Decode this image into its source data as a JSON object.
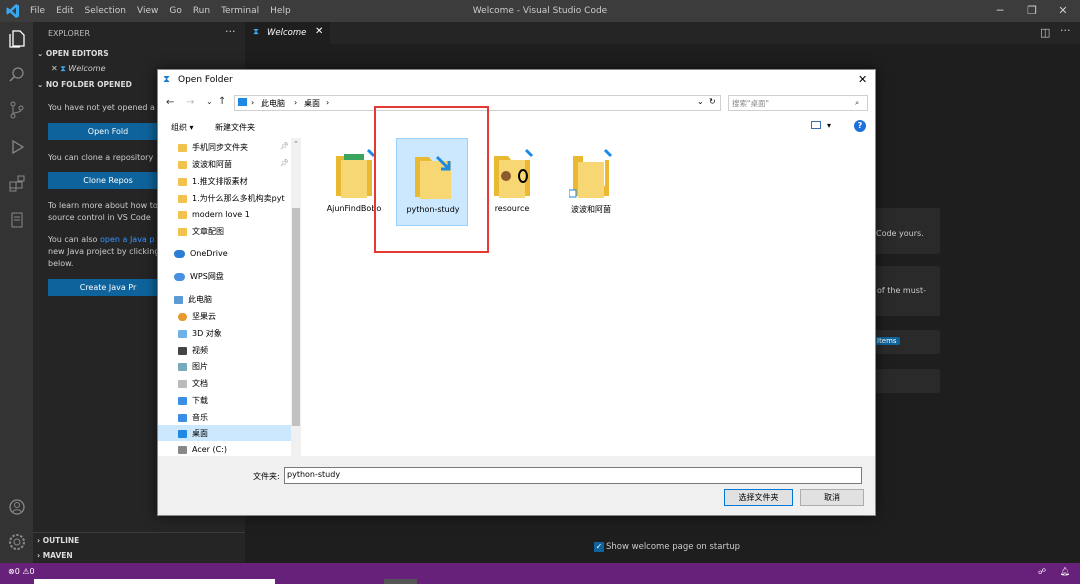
{
  "window": {
    "title": "Welcome - Visual Studio Code",
    "menu": [
      "File",
      "Edit",
      "Selection",
      "View",
      "Go",
      "Run",
      "Terminal",
      "Help"
    ]
  },
  "sidebar": {
    "title": "EXPLORER",
    "open_editors": "OPEN EDITORS",
    "open_editor_item": "Welcome",
    "no_folder": "NO FOLDER OPENED",
    "text1": "You have not yet opened a",
    "open_btn": "Open Fold",
    "text2": "You can clone a repository",
    "clone_btn": "Clone Repos",
    "text3a": "To learn more about how to",
    "text3b": "source control in VS Code",
    "text4a": "You can also",
    "text4link": "open a Java p",
    "text4b": "new Java project by clicking",
    "text4c": "below.",
    "java_btn": "Create Java Pr",
    "outline": "OUTLINE",
    "maven": "MAVEN"
  },
  "editor": {
    "tab": "Welcome",
    "card1": "Code yours.",
    "card2": "of the must-",
    "card3": "Items",
    "checkbox_label": "Show welcome page on startup"
  },
  "status": {
    "errors": "0",
    "warnings": "0"
  },
  "dialog": {
    "title": "Open Folder",
    "path": [
      "此电脑",
      "桌面"
    ],
    "search_placeholder": "搜索\"桌面\"",
    "organize": "组织 ▾",
    "new_folder": "新建文件夹",
    "nav": [
      "手机同步文件夹",
      "波波和阿菌",
      "1.推文排版素材",
      "1.为什么那么多机构卖pyt",
      "modern love 1",
      "文章配图",
      "OneDrive",
      "WPS网盘",
      "此电脑",
      "坚果云",
      "3D 对象",
      "视频",
      "图片",
      "文档",
      "下载",
      "音乐",
      "桌面",
      "Acer (C:)"
    ],
    "files": [
      "AjunFindBobo",
      "python-study",
      "resource",
      "波波和阿菌"
    ],
    "folder_label": "文件夹:",
    "folder_value": "python-study",
    "select_btn": "选择文件夹",
    "cancel_btn": "取消"
  }
}
